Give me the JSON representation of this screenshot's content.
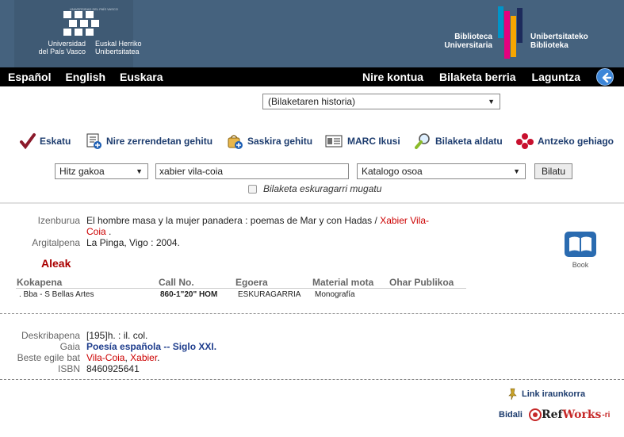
{
  "header": {
    "upv_tiny": "UNIVERSIDAD DEL PAÍS VASCO",
    "upv_left_line1": "Universidad",
    "upv_left_line2": "del País Vasco",
    "upv_right_line1": "Euskal Herriko",
    "upv_right_line2": "Unibertsitatea",
    "bib_left_line1": "Biblioteca",
    "bib_left_line2": "Universitaria",
    "bib_right_line1": "Unibertsitateko",
    "bib_right_line2": "Biblioteka"
  },
  "nav": {
    "left": [
      "Español",
      "English",
      "Euskara"
    ],
    "right": [
      "Nire kontua",
      "Bilaketa berria",
      "Laguntza"
    ]
  },
  "history": {
    "selected": "(Bilaketaren historia)"
  },
  "toolbar": {
    "eskatu": "Eskatu",
    "zerrenda": "Nire zerrendetan gehitu",
    "saskira": "Saskira gehitu",
    "marc": "MARC Ikusi",
    "aldatu": "Bilaketa aldatu",
    "antzeko": "Antzeko gehiago"
  },
  "search": {
    "field_selected": "Hitz gakoa",
    "query": "xabier vila-coia",
    "scope_selected": "Katalogo osoa",
    "submit": "Bilatu",
    "available_label": "Bilaketa eskuragarri mugatu"
  },
  "record": {
    "title_label": "Izenburua",
    "title_main": "El hombre masa y la mujer panadera : poemas de Mar y con Hadas",
    "title_sep": " / ",
    "title_author_a": "Xabier Vila-",
    "title_author_b": "Coia",
    "title_end": " .",
    "pub_label": "Argitalpena",
    "pub_value": "La Pinga, Vigo : 2004.",
    "format": "Book"
  },
  "copies": {
    "heading": "Aleak",
    "columns": [
      "Kokapena",
      "Call No.",
      "Egoera",
      "Material mota",
      "Ohar Publikoa"
    ],
    "rows": [
      [
        ". Bba - S Bellas Artes",
        "860-1\"20\" HOM",
        "ESKURAGARRIA",
        "Monografía",
        ""
      ]
    ]
  },
  "details": {
    "desc_label": "Deskribapena",
    "desc_value": "[195]h. : il. col.",
    "gaia_label": "Gaia",
    "gaia_value": "Poesía española -- Siglo XXI.",
    "beste_label": "Beste egile bat",
    "beste_a": "Vila-Coia",
    "beste_sep": ", ",
    "beste_b": "Xabier",
    "beste_end": ".",
    "isbn_label": "ISBN",
    "isbn_value": "8460925641"
  },
  "footer": {
    "permalink": "Link iraunkorra",
    "bidali": "Bidali",
    "refworks_a": "Ref",
    "refworks_b": "Works",
    "refworks_suffix": "-ri"
  }
}
